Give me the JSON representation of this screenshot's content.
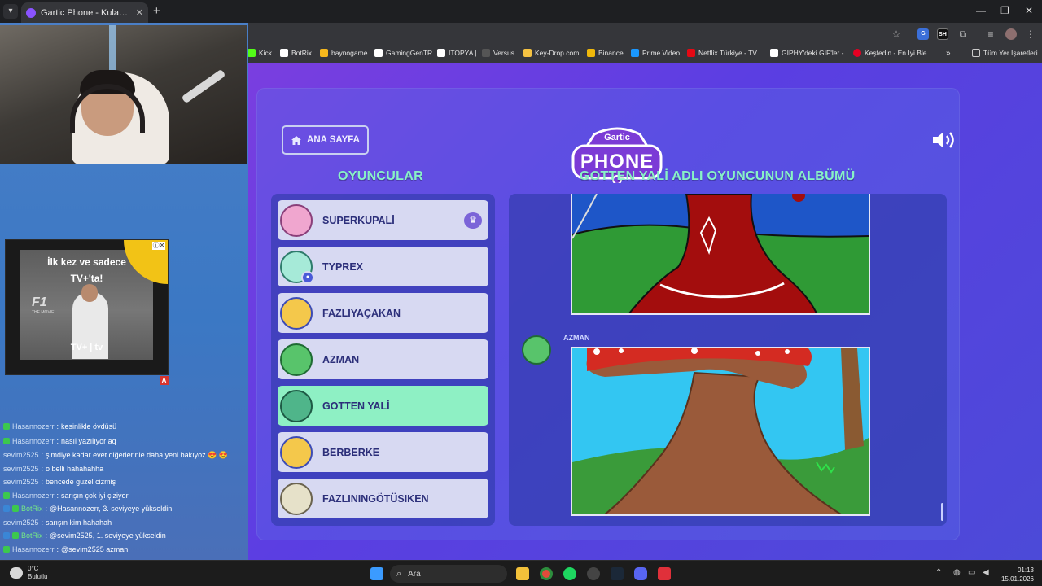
{
  "browser": {
    "tab_title": "Gartic Phone - Kulaktan Kulağa",
    "bookmarks": [
      {
        "label": "Kick",
        "color": "#53fc18"
      },
      {
        "label": "BotRix",
        "color": "#ffffff"
      },
      {
        "label": "baynogame",
        "color": "#f6b81d"
      },
      {
        "label": "GamingGenTR",
        "color": "#ffffff"
      },
      {
        "label": "İTOPYA |",
        "color": "#ffffff"
      },
      {
        "label": "Versus",
        "color": "#555555"
      },
      {
        "label": "Key-Drop.com",
        "color": "#f5c242"
      },
      {
        "label": "Binance",
        "color": "#f0b90b"
      },
      {
        "label": "Prime Video",
        "color": "#1a98ff"
      },
      {
        "label": "Netflix Türkiye - TV...",
        "color": "#e50914"
      },
      {
        "label": "GIPHY'deki GIF'ler -...",
        "color": "#ffffff"
      },
      {
        "label": "Keşfedin - En İyi Ble...",
        "color": "#e60023"
      }
    ],
    "bookmarks_more": "»",
    "all_bookmarks": "Tüm Yer İşaretleri"
  },
  "ad": {
    "line1": "İlk kez ve sadece",
    "line2": "TV+'ta!",
    "f1": "F1",
    "subtitle": "THE MOVIE",
    "bottom": "TV+ | tv",
    "mark": "A"
  },
  "chat": [
    {
      "user": "Hasannozerr",
      "msg": "kesinlikle övdüsü",
      "badge": "#3cc84f"
    },
    {
      "user": "Hasannozerr",
      "msg": "nasıl yazılıyor aq",
      "badge": "#3cc84f"
    },
    {
      "user": "sevim2525",
      "msg": "şimdiye kadar evet diğerlerinie daha yeni bakıyoz 😍 😍",
      "badge": ""
    },
    {
      "user": "sevim2525",
      "msg": "o belli hahahahha",
      "badge": ""
    },
    {
      "user": "sevim2525",
      "msg": "bencede guzel cizmiş",
      "badge": ""
    },
    {
      "user": "Hasannozerr",
      "msg": "sarışın çok iyi çiziyor",
      "badge": "#3cc84f"
    },
    {
      "user": "BotRix",
      "msg": "@Hasannozerr, 3. seviyeye yükseldin",
      "badge": "#3cc84f",
      "bot": true
    },
    {
      "user": "sevim2525",
      "msg": "sarışın kim hahahah",
      "badge": ""
    },
    {
      "user": "BotRix",
      "msg": "@sevim2525, 1. seviyeye yükseldin",
      "badge": "#3cc84f",
      "bot": true
    },
    {
      "user": "Hasannozerr",
      "msg": "@sevim2525 azman",
      "badge": "#3cc84f"
    }
  ],
  "game": {
    "home_label": "ANA SAYFA",
    "logo_top": "Gartic",
    "logo_bottom": "PHONE",
    "players_title": "OYUNCULAR",
    "album_title": "GOTTEN YALİ ADLI OYUNCUNUN ALBÜMÜ",
    "players": [
      {
        "name": "SUPERKUPALİ",
        "avatar": "#f0a6cf",
        "host": true
      },
      {
        "name": "TYPREX",
        "avatar": "#a6ead8",
        "sub": true
      },
      {
        "name": "FAZLIYAÇAKAN",
        "avatar": "#f4c84b"
      },
      {
        "name": "AZMAN",
        "avatar": "#58c46b"
      },
      {
        "name": "GOTTEN YALİ",
        "avatar": "#4fb58a",
        "active": true
      },
      {
        "name": "BERBERKE",
        "avatar": "#f4c84b"
      },
      {
        "name": "FAZLININGÖTÜSIKEN",
        "avatar": "#e6e1c9"
      }
    ],
    "album_author": "AZMAN",
    "colors": {
      "accent": "#88f2c6",
      "button": "#d7d9f2",
      "active": "#8ef0c4"
    }
  },
  "taskbar": {
    "temp": "0°C",
    "weather": "Bulutlu",
    "search": "Ara",
    "time": "01:13",
    "date": "15.01.2026"
  }
}
